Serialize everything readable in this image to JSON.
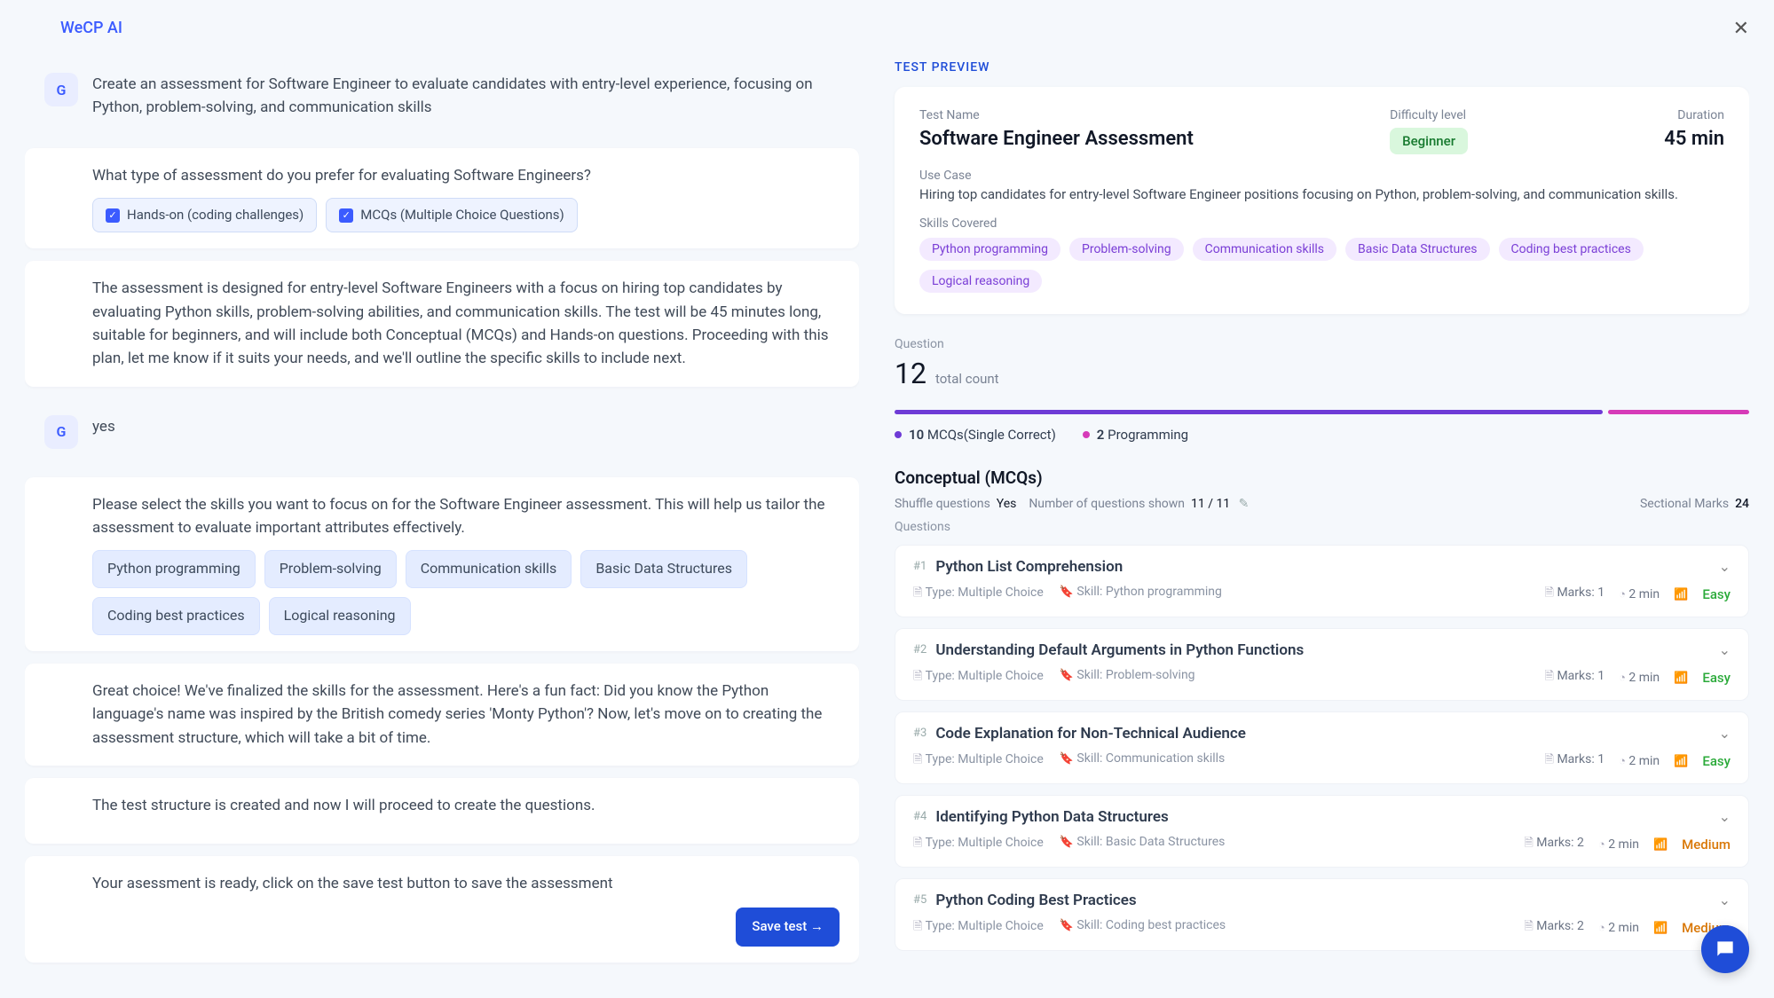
{
  "brand": "WeCP AI",
  "user_initial": "G",
  "chat": {
    "m1": "Create an assessment for Software Engineer to evaluate candidates with entry-level experience, focusing on Python, problem-solving, and communication skills",
    "m2": "What type of assessment do you prefer for evaluating Software Engineers?",
    "m2_opts": [
      "Hands-on (coding challenges)",
      "MCQs (Multiple Choice Questions)"
    ],
    "m3": "The assessment is designed for entry-level Software Engineers with a focus on hiring top candidates by evaluating Python skills, problem-solving abilities, and communication skills. The test will be 45 minutes long, suitable for beginners, and will include both Conceptual (MCQs) and Hands-on questions. Proceeding with this plan, let me know if it suits your needs, and we'll outline the specific skills to include next.",
    "m4": "yes",
    "m5": "Please select the skills you want to focus on for the Software Engineer assessment. This will help us tailor the assessment to evaluate important attributes effectively.",
    "m5_skills": [
      "Python programming",
      "Problem-solving",
      "Communication skills",
      "Basic Data Structures",
      "Coding best practices",
      "Logical reasoning"
    ],
    "m6": "Great choice! We've finalized the skills for the assessment. Here's a fun fact: Did you know the Python language's name was inspired by the British comedy series 'Monty Python'? Now, let's move on to creating the assessment structure, which will take a bit of time.",
    "m7": "The test structure is created and now I will proceed to create the questions.",
    "m8": "Your asessment is ready, click on the save test button to save the assessment",
    "save_label": "Save test →"
  },
  "preview": {
    "heading": "TEST PREVIEW",
    "labels": {
      "test_name": "Test Name",
      "difficulty": "Difficulty level",
      "duration": "Duration",
      "use_case": "Use Case",
      "skills_covered": "Skills Covered",
      "question": "Question",
      "total_count": "total count",
      "questions": "Questions",
      "shuffle": "Shuffle questions",
      "num_shown": "Number of questions shown",
      "sectional_marks": "Sectional Marks"
    },
    "test_name": "Software Engineer Assessment",
    "difficulty": "Beginner",
    "duration": "45 min",
    "use_case_text": "Hiring top candidates for entry-level Software Engineer positions focusing on Python, problem-solving, and communication skills.",
    "skills": [
      "Python programming",
      "Problem-solving",
      "Communication skills",
      "Basic Data Structures",
      "Coding best practices",
      "Logical reasoning"
    ],
    "qcount": "12",
    "legend_mcq_count": "10",
    "legend_mcq_label": "MCQs(Single Correct)",
    "legend_prog_count": "2",
    "legend_prog_label": "Programming",
    "section_title": "Conceptual (MCQs)",
    "shuffle_val": "Yes",
    "num_shown_val": "11 / 11",
    "sectional_marks_val": "24",
    "questions_list": [
      {
        "num": "#1",
        "title": "Python List Comprehension",
        "type": "Type: Multiple Choice",
        "skill": "Skill: Python programming",
        "marks": "Marks: 1",
        "time": "2 min",
        "diff": "Easy",
        "diff_class": "diff-easy"
      },
      {
        "num": "#2",
        "title": "Understanding Default Arguments in Python Functions",
        "type": "Type: Multiple Choice",
        "skill": "Skill: Problem-solving",
        "marks": "Marks: 1",
        "time": "2 min",
        "diff": "Easy",
        "diff_class": "diff-easy"
      },
      {
        "num": "#3",
        "title": "Code Explanation for Non-Technical Audience",
        "type": "Type: Multiple Choice",
        "skill": "Skill: Communication skills",
        "marks": "Marks: 1",
        "time": "2 min",
        "diff": "Easy",
        "diff_class": "diff-easy"
      },
      {
        "num": "#4",
        "title": "Identifying Python Data Structures",
        "type": "Type: Multiple Choice",
        "skill": "Skill: Basic Data Structures",
        "marks": "Marks: 2",
        "time": "2 min",
        "diff": "Medium",
        "diff_class": "diff-medium"
      },
      {
        "num": "#5",
        "title": "Python Coding Best Practices",
        "type": "Type: Multiple Choice",
        "skill": "Skill: Coding best practices",
        "marks": "Marks: 2",
        "time": "2 min",
        "diff": "Medium",
        "diff_class": "diff-medium"
      }
    ]
  }
}
